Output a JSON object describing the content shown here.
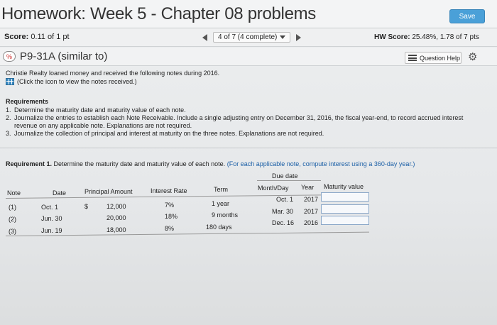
{
  "header": {
    "title": "Homework: Week 5 - Chapter 08 problems",
    "save_label": "Save"
  },
  "scorebar": {
    "score_label": "Score:",
    "score_value": "0.11 of 1 pt",
    "pager_text": "4 of 7 (4 complete)",
    "hw_label": "HW Score:",
    "hw_value": "25.48%, 1.78 of 7 pts"
  },
  "question": {
    "icon_text": "%",
    "title": "P9-31A (similar to)",
    "help_label": "Question Help"
  },
  "body": {
    "intro": "Christie Realty loaned money and received the following notes during 2016.",
    "notes_link": "(Click the icon to view the notes received.)",
    "requirements_heading": "Requirements",
    "requirements": [
      {
        "n": "1.",
        "text": "Determine the maturity date and maturity value of each note."
      },
      {
        "n": "2.",
        "text": "Journalize the entries to establish each Note Receivable. Include a single adjusting entry on December 31, 2016, the fiscal year-end, to record accrued interest revenue on any applicable note. Explanations are not required."
      },
      {
        "n": "3.",
        "text": "Journalize the collection of principal and interest at maturity on the three notes. Explanations are not required."
      }
    ],
    "req1_bold": "Requirement 1.",
    "req1_text": "Determine the maturity date and maturity value of each note.",
    "req1_note": "(For each applicable note, compute interest using a 360-day year.)"
  },
  "table": {
    "due_date_header": "Due date",
    "headers": {
      "note": "Note",
      "date": "Date",
      "principal": "Principal Amount",
      "rate": "Interest Rate",
      "term": "Term",
      "monthday": "Month/Day",
      "year": "Year",
      "maturity": "Maturity value"
    },
    "currency": "$",
    "rows": [
      {
        "note": "(1)",
        "date": "Oct. 1",
        "principal": "12,000",
        "rate": "7%",
        "term": "1 year",
        "monthday": "Oct. 1",
        "year": "2017",
        "maturity": ""
      },
      {
        "note": "(2)",
        "date": "Jun. 30",
        "principal": "20,000",
        "rate": "18%",
        "term": "9 months",
        "monthday": "Mar. 30",
        "year": "2017",
        "maturity": ""
      },
      {
        "note": "(3)",
        "date": "Jun. 19",
        "principal": "18,000",
        "rate": "8%",
        "term": "180 days",
        "monthday": "Dec. 16",
        "year": "2016",
        "maturity": ""
      }
    ]
  },
  "colors": {
    "save_button": "#4aa0d8",
    "link_blue": "#1b5fa6",
    "input_border": "#8aa7c8"
  },
  "icons": {
    "nav_prev": "triangle-left",
    "nav_next": "triangle-right",
    "help": "list-icon",
    "settings": "gear-icon",
    "notes": "grid-icon"
  }
}
